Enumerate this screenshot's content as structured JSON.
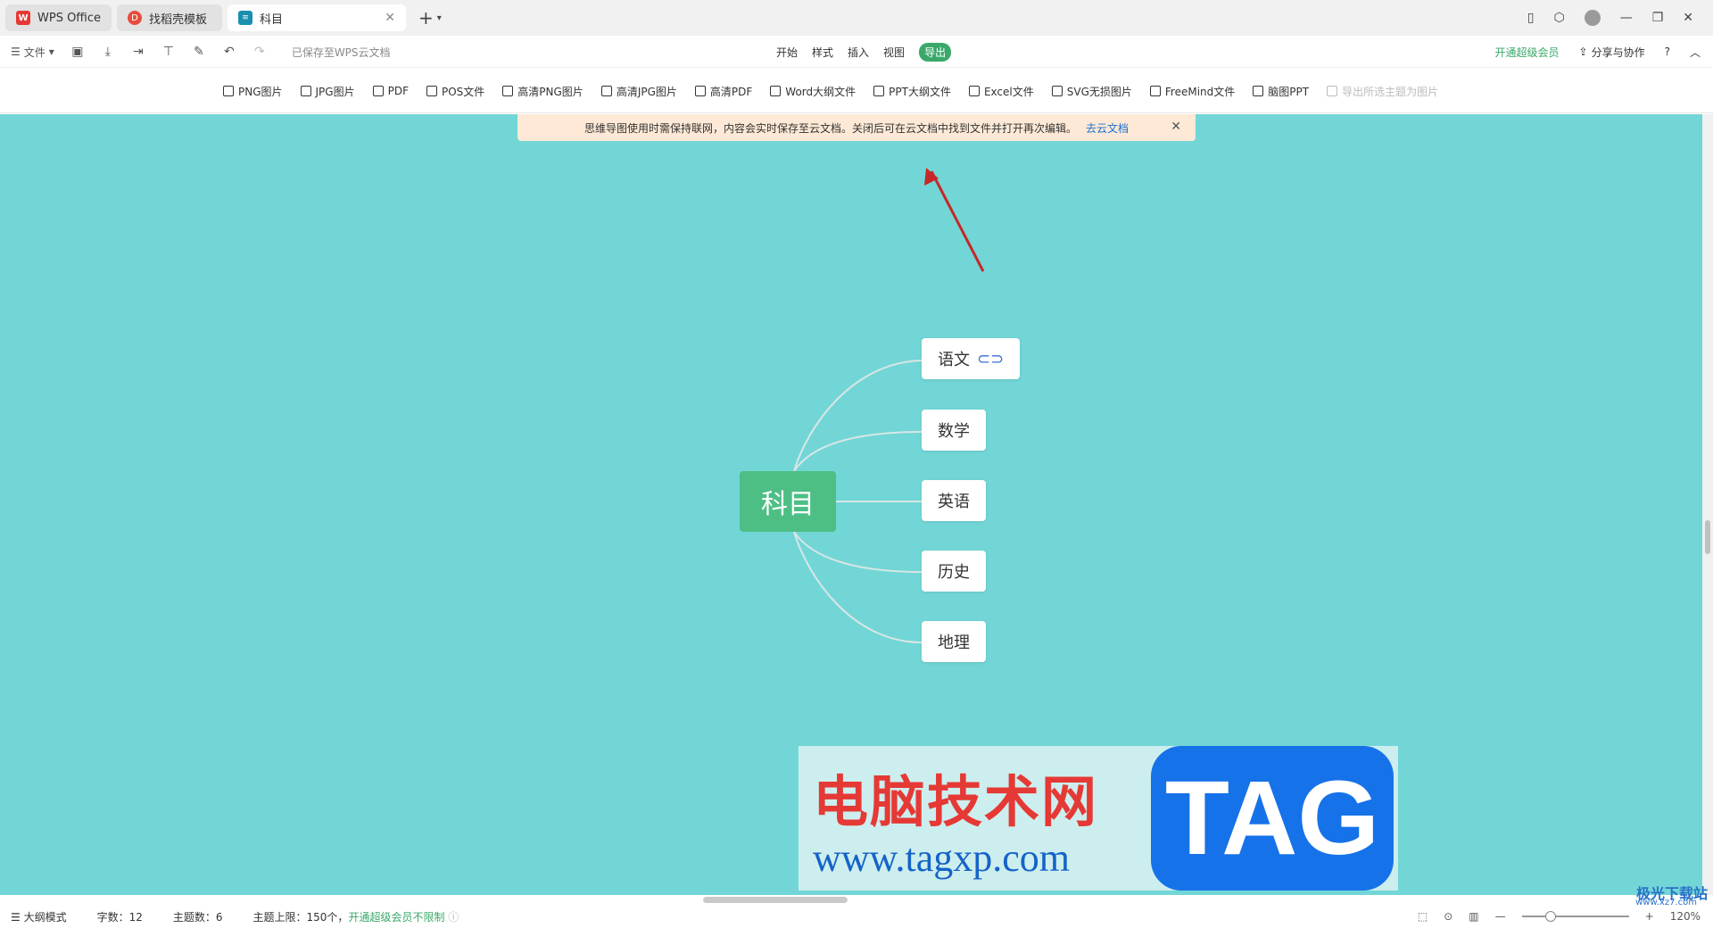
{
  "tabs": [
    {
      "label": "WPS Office",
      "icon": "wps-logo-icon"
    },
    {
      "label": "找稻壳模板",
      "icon": "docer-logo-icon"
    },
    {
      "label": "科目",
      "icon": "mindmap-file-icon",
      "active": true
    }
  ],
  "menubar": {
    "file_label": "文件",
    "save_status": "已保存至WPS云文档",
    "tabs": [
      "开始",
      "样式",
      "插入",
      "视图",
      "导出"
    ],
    "active_tab": "导出",
    "vip_label": "开通超级会员",
    "share_label": "分享与协作",
    "help_label": "?"
  },
  "ribbon": {
    "items": [
      {
        "label": "PNG图片",
        "icon": "image-icon"
      },
      {
        "label": "JPG图片",
        "icon": "image-icon"
      },
      {
        "label": "PDF",
        "icon": "pdf-icon"
      },
      {
        "label": "POS文件",
        "icon": "pos-icon"
      },
      {
        "label": "高清PNG图片",
        "icon": "hd-image-icon"
      },
      {
        "label": "高清JPG图片",
        "icon": "hd-image-icon"
      },
      {
        "label": "高清PDF",
        "icon": "hd-pdf-icon"
      },
      {
        "label": "Word大纲文件",
        "icon": "word-icon"
      },
      {
        "label": "PPT大纲文件",
        "icon": "ppt-icon"
      },
      {
        "label": "Excel文件",
        "icon": "excel-icon"
      },
      {
        "label": "SVG无损图片",
        "icon": "svg-icon"
      },
      {
        "label": "FreeMind文件",
        "icon": "freemind-icon"
      },
      {
        "label": "脑图PPT",
        "icon": "mindmap-ppt-icon"
      },
      {
        "label": "导出所选主题为图片",
        "icon": "image-icon",
        "disabled": true
      }
    ]
  },
  "notice": {
    "text": "思维导图使用时需保持联网，内容会实时保存至云文档。关闭后可在云文档中找到文件并打开再次编辑。",
    "link": "去云文档"
  },
  "mindmap": {
    "root": "科目",
    "children": [
      "语文",
      "数学",
      "英语",
      "历史",
      "地理"
    ],
    "colors": {
      "canvas": "#72d6d6",
      "root": "#4dbf85",
      "line": "#d8e6e6"
    }
  },
  "watermark": {
    "title": "电脑技术网",
    "url": "www.tagxp.com",
    "tag": "TAG",
    "badge": "极光下载站",
    "badge_sub": "www.xz7.com"
  },
  "statusbar": {
    "outline_mode": "大纲模式",
    "word_count": "字数：12",
    "topic_count": "主题数：6",
    "topic_limit": "主题上限：150个，",
    "vip_unlimited": "开通超级会员不限制",
    "zoom": "120%"
  }
}
